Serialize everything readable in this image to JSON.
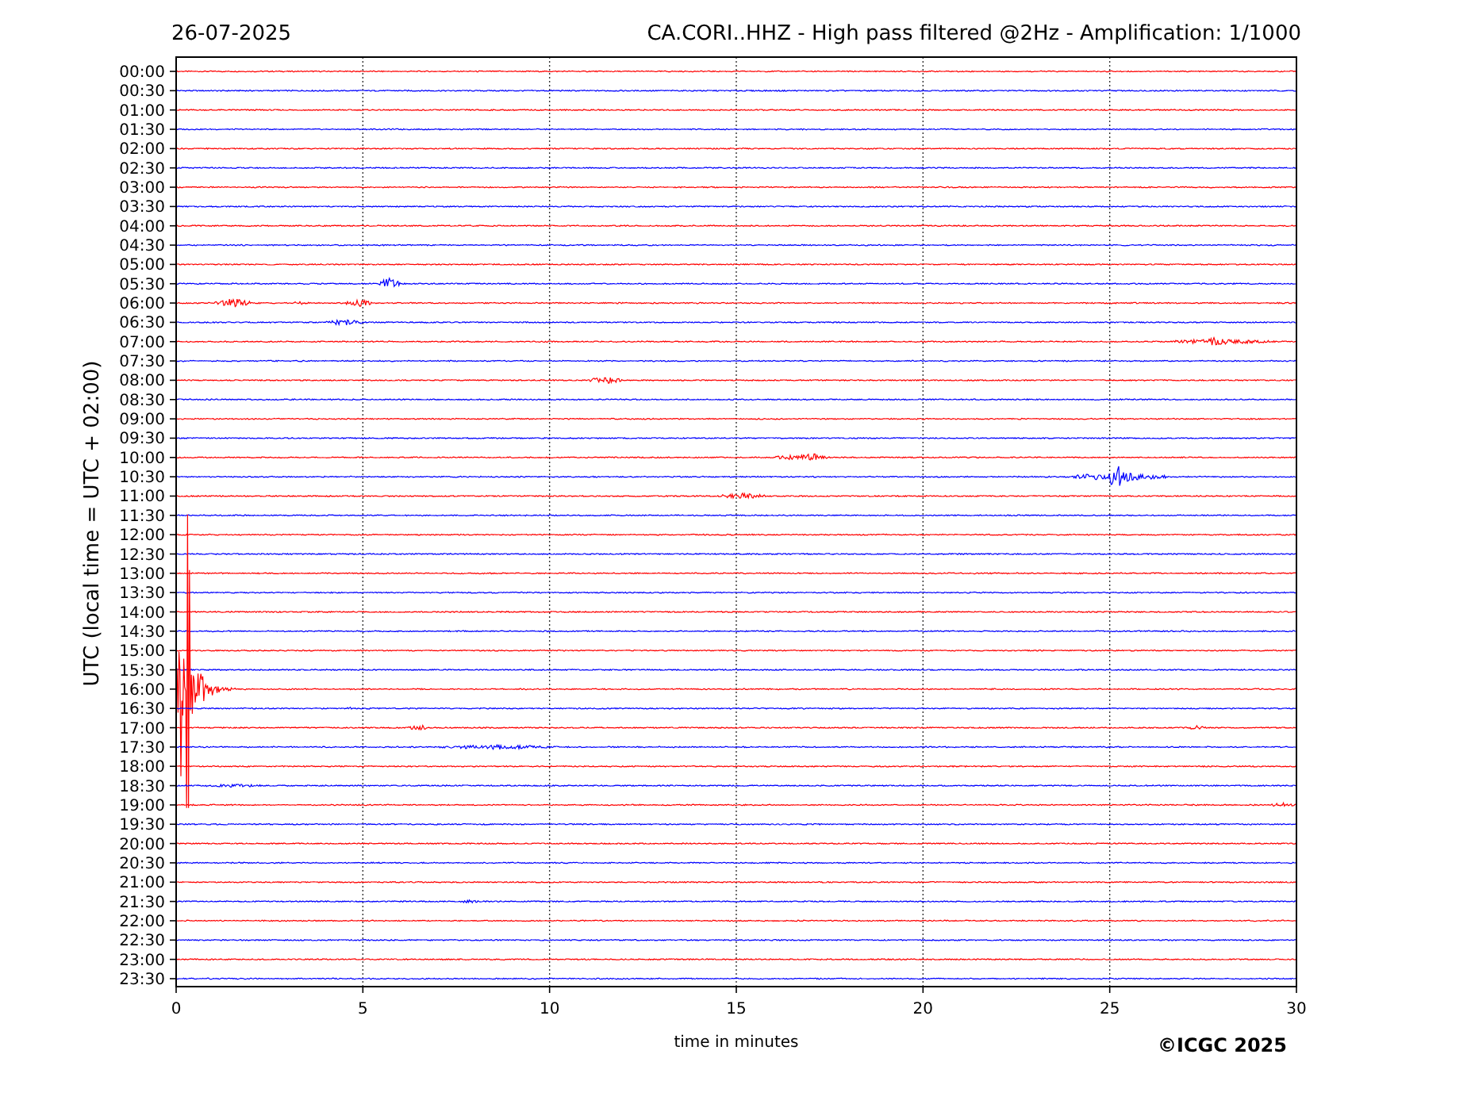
{
  "date": "26-07-2025",
  "title": "CA.CORI..HHZ - High pass filtered @2Hz - Amplification: 1/1000",
  "y_axis_label": "UTC (local time = UTC + 02:00)",
  "x_axis_label": "time in minutes",
  "x_ticks": [
    "0",
    "5",
    "10",
    "15",
    "20",
    "25",
    "30"
  ],
  "rows": [
    {
      "label": "00:00",
      "color": "#ff0000"
    },
    {
      "label": "00:30",
      "color": "#0000ff"
    },
    {
      "label": "01:00",
      "color": "#ff0000"
    },
    {
      "label": "01:30",
      "color": "#0000ff"
    },
    {
      "label": "02:00",
      "color": "#ff0000"
    },
    {
      "label": "02:30",
      "color": "#0000ff"
    },
    {
      "label": "03:00",
      "color": "#ff0000"
    },
    {
      "label": "03:30",
      "color": "#0000ff"
    },
    {
      "label": "04:00",
      "color": "#ff0000"
    },
    {
      "label": "04:30",
      "color": "#0000ff"
    },
    {
      "label": "05:00",
      "color": "#ff0000"
    },
    {
      "label": "05:30",
      "color": "#0000ff"
    },
    {
      "label": "06:00",
      "color": "#ff0000"
    },
    {
      "label": "06:30",
      "color": "#0000ff"
    },
    {
      "label": "07:00",
      "color": "#ff0000"
    },
    {
      "label": "07:30",
      "color": "#0000ff"
    },
    {
      "label": "08:00",
      "color": "#ff0000"
    },
    {
      "label": "08:30",
      "color": "#0000ff"
    },
    {
      "label": "09:00",
      "color": "#ff0000"
    },
    {
      "label": "09:30",
      "color": "#0000ff"
    },
    {
      "label": "10:00",
      "color": "#ff0000"
    },
    {
      "label": "10:30",
      "color": "#0000ff"
    },
    {
      "label": "11:00",
      "color": "#ff0000"
    },
    {
      "label": "11:30",
      "color": "#0000ff"
    },
    {
      "label": "12:00",
      "color": "#ff0000"
    },
    {
      "label": "12:30",
      "color": "#0000ff"
    },
    {
      "label": "13:00",
      "color": "#ff0000"
    },
    {
      "label": "13:30",
      "color": "#0000ff"
    },
    {
      "label": "14:00",
      "color": "#ff0000"
    },
    {
      "label": "14:30",
      "color": "#0000ff"
    },
    {
      "label": "15:00",
      "color": "#ff0000"
    },
    {
      "label": "15:30",
      "color": "#0000ff"
    },
    {
      "label": "16:00",
      "color": "#ff0000"
    },
    {
      "label": "16:30",
      "color": "#0000ff"
    },
    {
      "label": "17:00",
      "color": "#ff0000"
    },
    {
      "label": "17:30",
      "color": "#0000ff"
    },
    {
      "label": "18:00",
      "color": "#ff0000"
    },
    {
      "label": "18:30",
      "color": "#0000ff"
    },
    {
      "label": "19:00",
      "color": "#ff0000"
    },
    {
      "label": "19:30",
      "color": "#0000ff"
    },
    {
      "label": "20:00",
      "color": "#ff0000"
    },
    {
      "label": "20:30",
      "color": "#0000ff"
    },
    {
      "label": "21:00",
      "color": "#ff0000"
    },
    {
      "label": "21:30",
      "color": "#0000ff"
    },
    {
      "label": "22:00",
      "color": "#ff0000"
    },
    {
      "label": "22:30",
      "color": "#0000ff"
    },
    {
      "label": "23:00",
      "color": "#ff0000"
    },
    {
      "label": "23:30",
      "color": "#0000ff"
    }
  ],
  "copyright": "©ICGC 2025"
}
